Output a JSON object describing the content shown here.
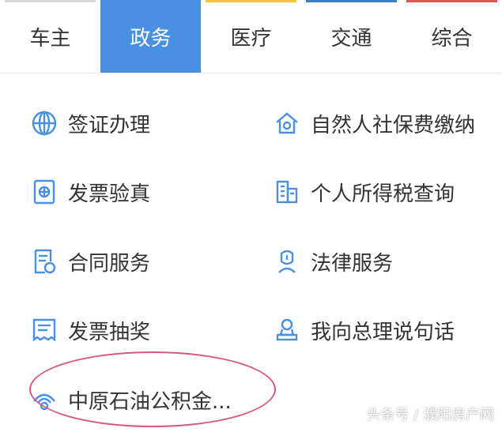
{
  "tabs": [
    {
      "label": "车主",
      "active": false,
      "strip_color": "#d9d9d9"
    },
    {
      "label": "政务",
      "active": true,
      "strip_color": "#4a90e2"
    },
    {
      "label": "医疗",
      "active": false,
      "strip_color": "#f5c542"
    },
    {
      "label": "交通",
      "active": false,
      "strip_color": "#3f7fbf"
    },
    {
      "label": "综合",
      "active": false,
      "strip_color": "#e05555"
    }
  ],
  "services": {
    "left": [
      {
        "label": "签证办理",
        "icon": "globe-icon"
      },
      {
        "label": "发票验真",
        "icon": "invoice-verify-icon"
      },
      {
        "label": "合同服务",
        "icon": "contract-icon"
      },
      {
        "label": "发票抽奖",
        "icon": "invoice-lottery-icon"
      },
      {
        "label": "中原石油公积金...",
        "icon": "provident-fund-icon"
      }
    ],
    "right": [
      {
        "label": "自然人社保费缴纳",
        "icon": "social-security-icon"
      },
      {
        "label": "个人所得税查询",
        "icon": "tax-building-icon"
      },
      {
        "label": "法律服务",
        "icon": "legal-icon"
      },
      {
        "label": "我向总理说句话",
        "icon": "person-stamp-icon"
      }
    ]
  },
  "watermark": "头条号 / 濮阳房产网",
  "colors": {
    "accent": "#4a90e2",
    "icon": "#4a90e2",
    "highlight": "#d8577f"
  }
}
